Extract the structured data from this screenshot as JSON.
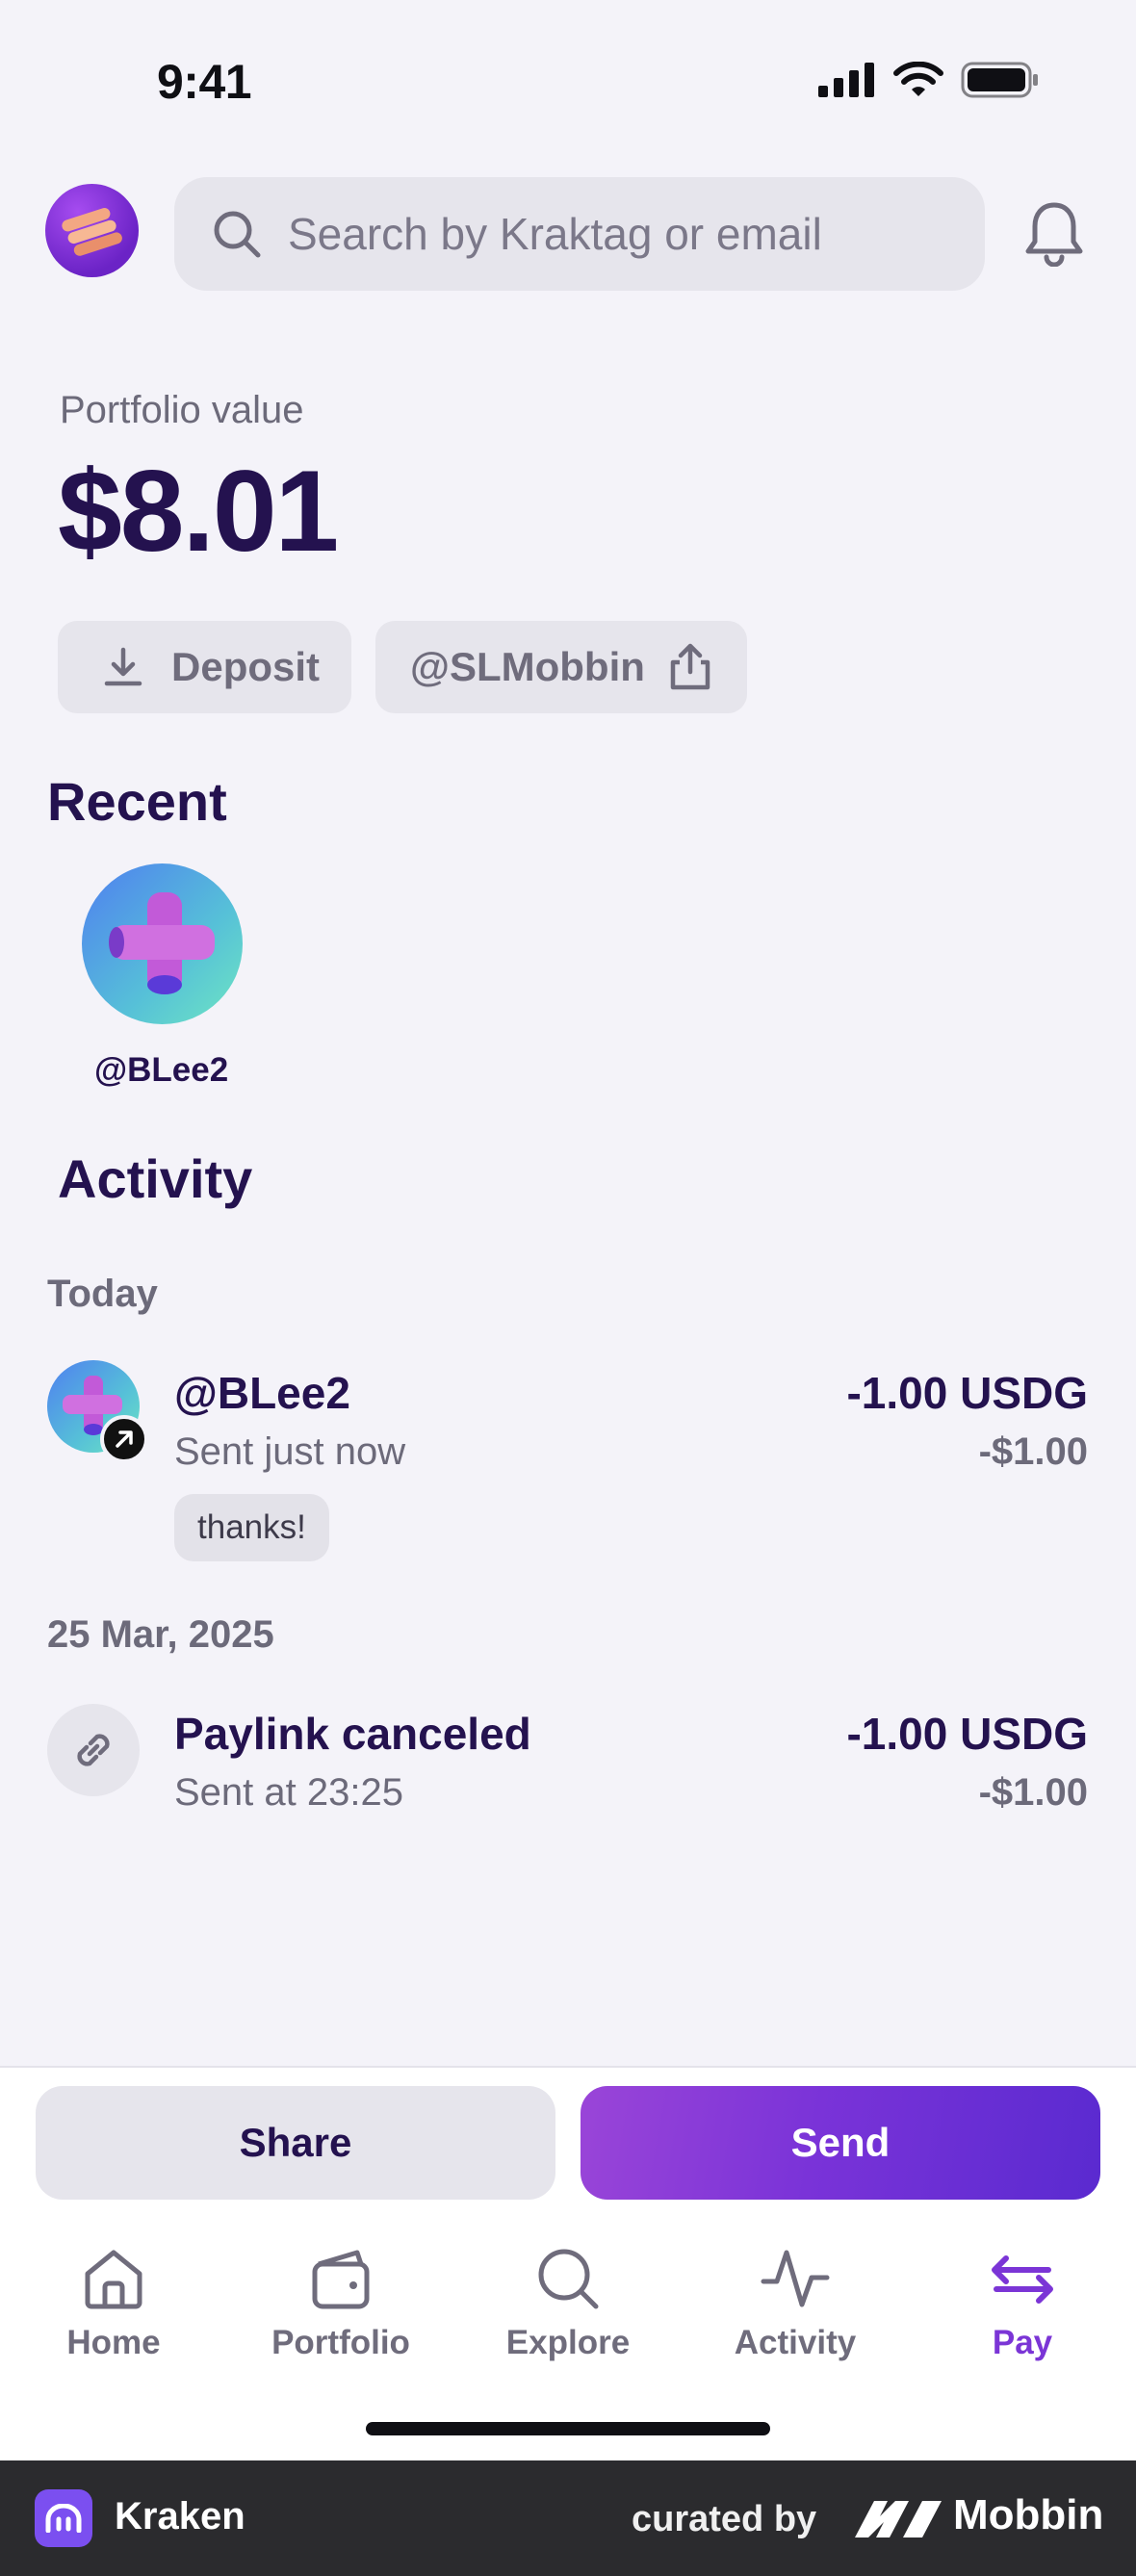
{
  "status_bar": {
    "time": "9:41"
  },
  "header": {
    "search_placeholder": "Search by Kraktag or email"
  },
  "portfolio": {
    "label": "Portfolio value",
    "value": "$8.01",
    "deposit_label": "Deposit",
    "kraktag_label": "@SLMobbin"
  },
  "recent": {
    "title": "Recent",
    "contacts": [
      {
        "name": "@BLee2"
      }
    ]
  },
  "activity": {
    "title": "Activity",
    "groups": [
      {
        "label": "Today",
        "items": [
          {
            "title": "@BLee2",
            "subtitle": "Sent just now",
            "note": "thanks!",
            "amount": "-1.00 USDG",
            "fiat": "-$1.00",
            "icon": "arrow-up-right-icon"
          }
        ]
      },
      {
        "label": "25 Mar, 2025",
        "items": [
          {
            "title": "Paylink canceled",
            "subtitle": "Sent at 23:25",
            "amount": "-1.00 USDG",
            "fiat": "-$1.00",
            "icon": "link-icon"
          }
        ]
      }
    ]
  },
  "actions": {
    "share_label": "Share",
    "send_label": "Send"
  },
  "tabs": [
    {
      "label": "Home",
      "icon": "home-icon"
    },
    {
      "label": "Portfolio",
      "icon": "wallet-icon"
    },
    {
      "label": "Explore",
      "icon": "search-icon"
    },
    {
      "label": "Activity",
      "icon": "activity-icon"
    },
    {
      "label": "Pay",
      "icon": "transfer-icon",
      "active": true
    }
  ],
  "footer": {
    "brand": "Kraken",
    "curated_by": "curated by",
    "curator": "Mobbin"
  },
  "colors": {
    "primary": "#24124f",
    "accent": "#7b35d6",
    "background": "#f4f3f9",
    "muted": "#6c6a7a"
  }
}
